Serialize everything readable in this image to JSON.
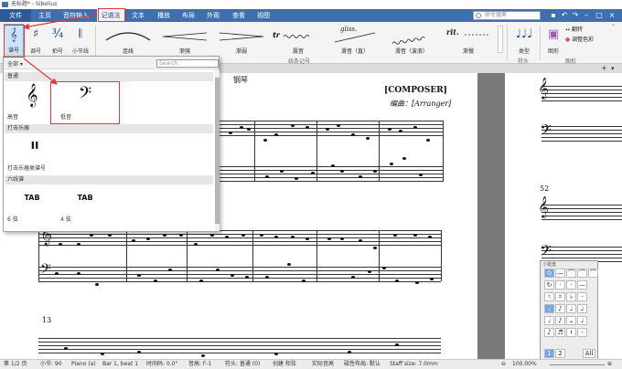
{
  "window": {
    "title": "无标题* - Sibelius"
  },
  "tabs": [
    "文件",
    "主页",
    "音符输入",
    "记谱法",
    "文本",
    "播放",
    "布局",
    "外观",
    "查看",
    "视图"
  ],
  "search": {
    "placeholder": "命令搜索"
  },
  "ribbon": {
    "buttons": {
      "clef": "谱号",
      "key": "调号",
      "time": "拍号",
      "barline": "小节线"
    },
    "lines": [
      "连线",
      "渐强",
      "渐弱",
      "震音",
      "滑音（直）",
      "滑音（波浪）",
      "渐慢"
    ],
    "line_glyphs": {
      "tremolo": "tr",
      "gliss": "gliss.",
      "rit": "rit."
    },
    "group_lines": "线条记号",
    "group_noteheads": "符头",
    "noteheads_label": "类型",
    "group_graphics": "图形",
    "graphics": {
      "image": "图形",
      "flip": "翻转",
      "adjust": "调整色彩"
    }
  },
  "panel": {
    "filter": "全部",
    "search_placeholder": "Search",
    "categories": [
      {
        "name": "普通",
        "items": [
          {
            "glyph": "𝄞",
            "label": "高音"
          },
          {
            "glyph": "𝄢",
            "label": "低音"
          }
        ]
      },
      {
        "name": "打击乐器",
        "items": [
          {
            "glyph": "𝄥",
            "label": "打击乐器类谱号"
          }
        ]
      },
      {
        "name": "六线谱",
        "items": [
          {
            "glyph": "TAB",
            "label": "6 弦"
          },
          {
            "glyph": "TAB",
            "label": "4 弦"
          }
        ]
      }
    ]
  },
  "score": {
    "instrument": "钢琴",
    "composer": "[COMPOSER]",
    "arranger": "编曲：[Arranger]",
    "bar_13": "13",
    "bar_52": "52"
  },
  "keypad": {
    "title": "小键盘",
    "rows": [
      [
        "⊙",
        "—",
        "⌒",
        "⌒",
        "⌒"
      ],
      [
        "↻",
        "·",
        "·",
        "—"
      ],
      [
        "♮",
        "♯",
        "♭",
        "·"
      ],
      [
        "♩",
        "♪",
        "♩",
        "♩"
      ],
      [
        "𝅗𝅥",
        "♪",
        "𝅝",
        "♩"
      ],
      [
        "♪",
        "♬",
        "𝄽",
        "·"
      ]
    ],
    "layout_tabs": [
      "1",
      "2",
      "All"
    ]
  },
  "status": {
    "page": "第 1/2 页",
    "bar_count": "小节: 90",
    "instrument": "Piano (a)",
    "position": "Bar 1, beat 1",
    "timecode": "时间码: 0.0\"",
    "pitch": "音高: F-1",
    "notehead": "符头: 普通 (0)",
    "mode": "创建 和弦",
    "concert": "实际音高",
    "layout": "磁性布局: 默认",
    "staff_size": "Staff size: 7.0mm",
    "zoom": "100.00%"
  },
  "colors": {
    "ribbon_tab": "#3f6fae",
    "highlight": "#e03a3a",
    "selected": "#cfe1f6"
  }
}
